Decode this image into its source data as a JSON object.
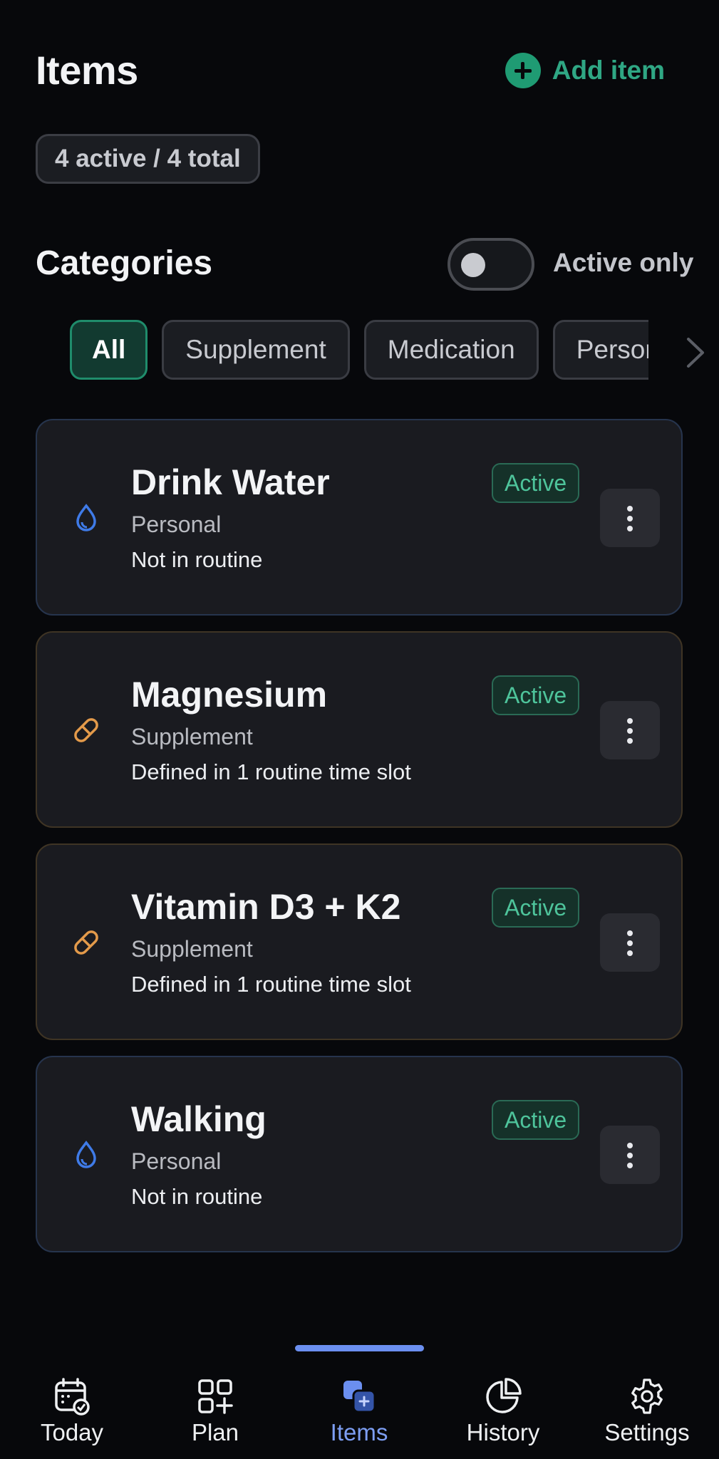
{
  "header": {
    "title": "Items",
    "add_label": "Add item"
  },
  "summary": {
    "count_label": "4 active / 4 total"
  },
  "categories": {
    "title": "Categories",
    "toggle_label": "Active only",
    "toggle_on": false,
    "chips": [
      "All",
      "Supplement",
      "Medication",
      "Personal"
    ]
  },
  "items": [
    {
      "name": "Drink Water",
      "category": "Personal",
      "routine": "Not in routine",
      "status": "Active",
      "icon": "water-drop-icon"
    },
    {
      "name": "Magnesium",
      "category": "Supplement",
      "routine": "Defined in 1 routine time slot",
      "status": "Active",
      "icon": "pill-icon"
    },
    {
      "name": "Vitamin D3 + K2",
      "category": "Supplement",
      "routine": "Defined in 1 routine time slot",
      "status": "Active",
      "icon": "pill-icon"
    },
    {
      "name": "Walking",
      "category": "Personal",
      "routine": "Not in routine",
      "status": "Active",
      "icon": "water-drop-icon"
    }
  ],
  "nav": {
    "items": [
      "Today",
      "Plan",
      "Items",
      "History",
      "Settings"
    ],
    "active": "Items"
  },
  "colors": {
    "background": "#07080b",
    "accent_green": "#2fa784",
    "accent_blue": "#7d9ef3",
    "personal_icon": "#3f7be8",
    "supplement_icon": "#e39a4a"
  }
}
